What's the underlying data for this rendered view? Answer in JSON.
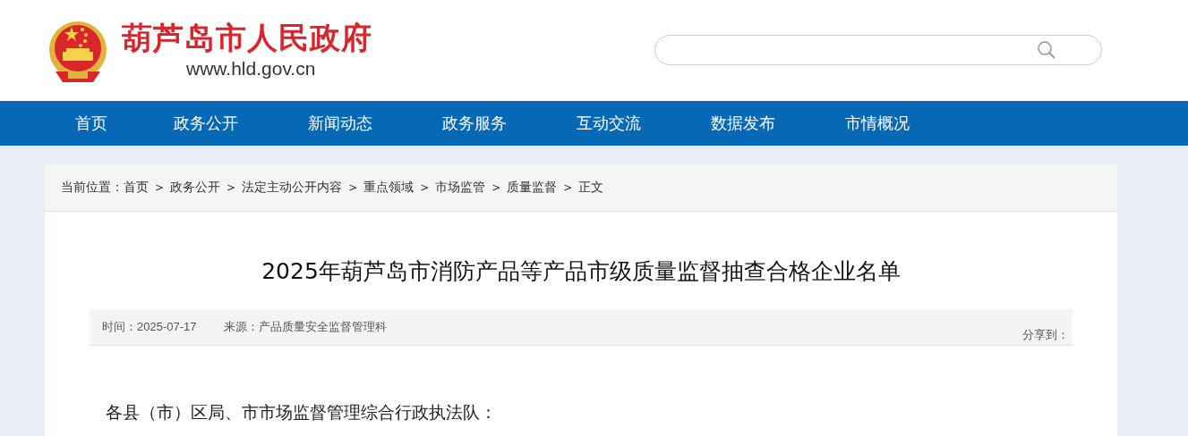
{
  "header": {
    "site_title": "葫芦岛市人民政府",
    "site_url": "www.hld.gov.cn"
  },
  "nav": [
    {
      "label": "首页"
    },
    {
      "label": "政务公开"
    },
    {
      "label": "新闻动态"
    },
    {
      "label": "政务服务"
    },
    {
      "label": "互动交流"
    },
    {
      "label": "数据发布"
    },
    {
      "label": "市情概况"
    }
  ],
  "breadcrumb": {
    "prefix": "当前位置：",
    "items": [
      "首页",
      "政务公开",
      "法定主动公开内容",
      "重点领域",
      "市场监管",
      "质量监督",
      "正文"
    ],
    "separators": [
      ">",
      ">",
      ">",
      ">",
      ">",
      ">"
    ]
  },
  "article": {
    "title": "2025年葫芦岛市消防产品等产品市级质量监督抽查合格企业名单",
    "time": "时间：2025-07-17",
    "source": "来源：产品质量安全监督管理科",
    "share": "分享到：",
    "body": [
      "各县（市）区局、市市场监督管理综合行政执法队："
    ]
  }
}
